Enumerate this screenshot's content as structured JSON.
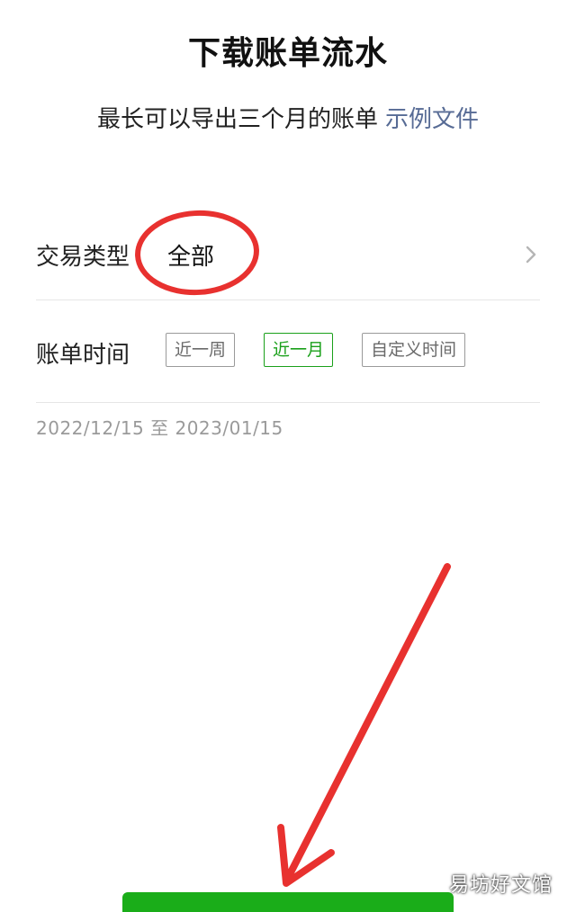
{
  "header": {
    "title": "下载账单流水"
  },
  "subtitle": {
    "text": "最长可以导出三个月的账单",
    "link_label": "示例文件"
  },
  "transaction_type": {
    "label": "交易类型",
    "value": "全部",
    "chevron_icon": "chevron-right-icon"
  },
  "bill_time": {
    "label": "账单时间",
    "options": [
      "近一周",
      "近一月",
      "自定义时间"
    ],
    "selected": "近一月"
  },
  "date_range": "2022/12/15 至 2023/01/15",
  "watermark": "易坊好文馆",
  "colors": {
    "accent_green": "#1aad19",
    "link_blue": "#576b95",
    "annotation_red": "#e8312f"
  }
}
